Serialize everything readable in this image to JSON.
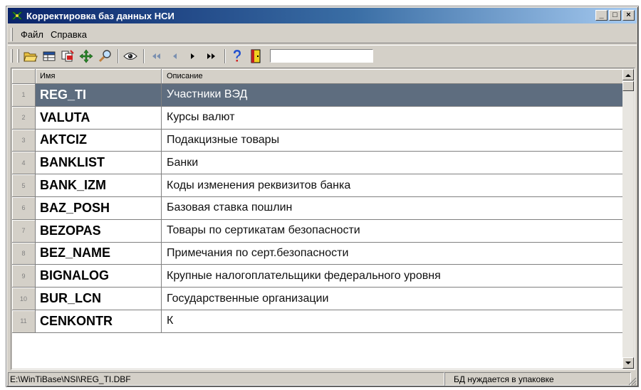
{
  "window": {
    "title": "Корректировка баз данных НСИ"
  },
  "titlebar_buttons": {
    "minimize": "_",
    "maximize": "□",
    "close": "×"
  },
  "menu": [
    {
      "label": "Файл"
    },
    {
      "label": "Справка"
    }
  ],
  "toolbar": {
    "tools": [
      "open-folder-icon",
      "grid-view-icon",
      "copy-documents-icon",
      "move-arrows-icon",
      "magnifier-icon",
      "view-eye-icon",
      "first-record-icon",
      "prev-record-icon",
      "next-record-icon",
      "last-record-icon",
      "help-icon",
      "exit-door-icon"
    ],
    "search_value": ""
  },
  "table": {
    "columns": {
      "name": "Имя",
      "description": "Описание"
    },
    "rows": [
      {
        "n": "1",
        "name": "REG_TI",
        "description": "Участники ВЭД",
        "selected": true
      },
      {
        "n": "2",
        "name": "VALUTA",
        "description": "Курсы валют"
      },
      {
        "n": "3",
        "name": "AKTCIZ",
        "description": "Подакцизные товары"
      },
      {
        "n": "4",
        "name": "BANKLIST",
        "description": "Банки"
      },
      {
        "n": "5",
        "name": "BANK_IZM",
        "description": "Коды изменения реквизитов банка"
      },
      {
        "n": "6",
        "name": "BAZ_POSH",
        "description": "Базовая ставка пошлин"
      },
      {
        "n": "7",
        "name": "BEZOPAS",
        "description": "Товары по сертикатам безопасности"
      },
      {
        "n": "8",
        "name": "BEZ_NAME",
        "description": "Примечания по серт.безопасности"
      },
      {
        "n": "9",
        "name": "BIGNALOG",
        "description": "Крупные налогоплательщики федерального уровня"
      },
      {
        "n": "10",
        "name": "BUR_LCN",
        "description": "Государственные организации"
      },
      {
        "n": "11",
        "name": "CENKONTR",
        "description": "К"
      }
    ]
  },
  "status": {
    "path": "E:\\WinTiBase\\NSI\\REG_TI.DBF",
    "message": "БД нуждается в упаковке"
  },
  "colors": {
    "selection": "#5e6d7f",
    "title_from": "#0a246a",
    "title_to": "#a6caf0",
    "face": "#d4d0c8"
  }
}
